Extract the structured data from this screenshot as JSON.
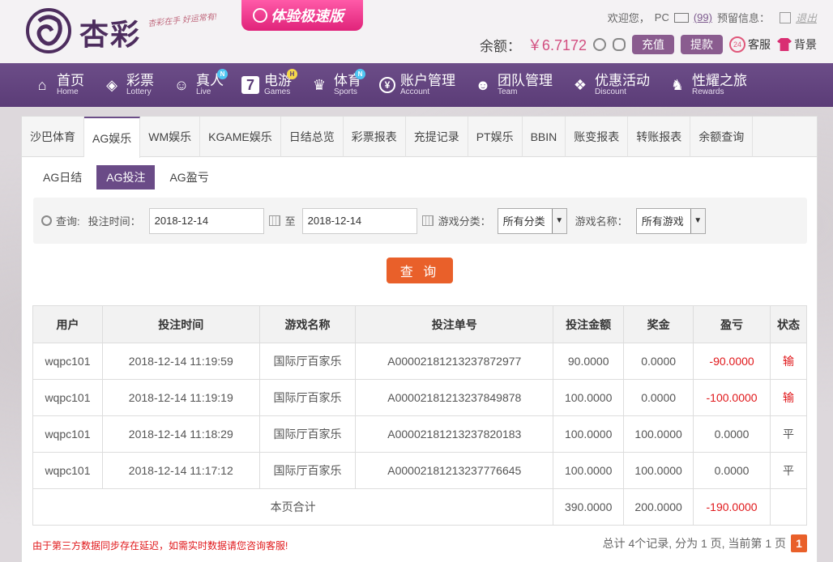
{
  "header": {
    "logo_text": "杏彩",
    "slogan": "杏彩在手 好运常有!",
    "promo": "体验极速版",
    "welcome": "欢迎您，",
    "user": "PC",
    "mail_count": "(99)",
    "warn_label": "预留信息：",
    "logout": "退出",
    "balance_label": "余额：",
    "balance": "￥6.7172",
    "recharge": "充值",
    "withdraw": "提款",
    "service": "客服",
    "background": "背景"
  },
  "nav": {
    "items": [
      {
        "cn": "首页",
        "en": "Home",
        "icon": "home-icon"
      },
      {
        "cn": "彩票",
        "en": "Lottery",
        "icon": "lottery-icon"
      },
      {
        "cn": "真人",
        "en": "Live",
        "icon": "live-icon",
        "badge": "N"
      },
      {
        "cn": "电游",
        "en": "Games",
        "icon": "games-icon",
        "badge": "H"
      },
      {
        "cn": "体育",
        "en": "Sports",
        "icon": "trophy-icon",
        "badge": "N"
      },
      {
        "cn": "账户管理",
        "en": "Account",
        "icon": "account-icon"
      },
      {
        "cn": "团队管理",
        "en": "Team",
        "icon": "team-icon"
      },
      {
        "cn": "优惠活动",
        "en": "Discount",
        "icon": "gift-icon"
      },
      {
        "cn": "性耀之旅",
        "en": "Rewards",
        "icon": "rewards-icon"
      }
    ]
  },
  "tabs": [
    "沙巴体育",
    "AG娱乐",
    "WM娱乐",
    "KGAME娱乐",
    "日结总览",
    "彩票报表",
    "充提记录",
    "PT娱乐",
    "BBIN",
    "账变报表",
    "转账报表",
    "余额查询"
  ],
  "subtabs": [
    "AG日结",
    "AG投注",
    "AG盈亏"
  ],
  "filter": {
    "query_label": "查询:",
    "time_label": "投注时间：",
    "start_date": "2018-12-14",
    "to": "至",
    "end_date": "2018-12-14",
    "category_label": "游戏分类：",
    "category_value": "所有分类",
    "game_label": "游戏名称：",
    "game_value": "所有游戏",
    "query_button": "查 询"
  },
  "table": {
    "headers": [
      "用户",
      "投注时间",
      "游戏名称",
      "投注单号",
      "投注金额",
      "奖金",
      "盈亏",
      "状态"
    ],
    "rows": [
      [
        "wqpc101",
        "2018-12-14 11:19:59",
        "国际厅百家乐",
        "A0000218121323787 2977",
        "90.0000",
        "0.0000",
        "-90.0000",
        "输"
      ],
      [
        "wqpc101",
        "2018-12-14 11:19:19",
        "国际厅百家乐",
        "A00002181213237849878",
        "100.0000",
        "0.0000",
        "-100.0000",
        "输"
      ],
      [
        "wqpc101",
        "2018-12-14 11:18:29",
        "国际厅百家乐",
        "A00002181213237820183",
        "100.0000",
        "100.0000",
        "0.0000",
        "平"
      ],
      [
        "wqpc101",
        "2018-12-14 11:17:12",
        "国际厅百家乐",
        "A00002181213237776645",
        "100.0000",
        "100.0000",
        "0.0000",
        "平"
      ]
    ],
    "total_label": "本页合计",
    "total_bet": "390.0000",
    "total_bonus": "200.0000",
    "total_profit": "-190.0000"
  },
  "notice": "由于第三方数据同步存在延迟，如需实时数据请您咨询客服!",
  "pager": {
    "summary": "总计 4个记录, 分为 1 页, 当前第 1 页",
    "page": "1"
  }
}
